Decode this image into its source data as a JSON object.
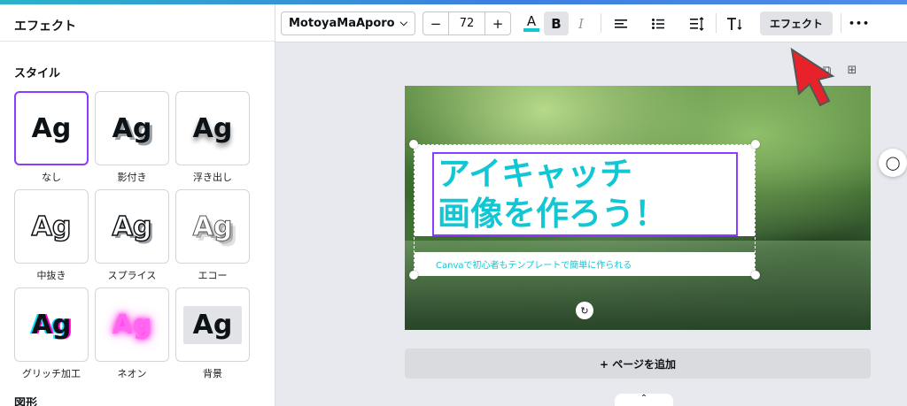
{
  "panel": {
    "title": "エフェクト",
    "styles_title": "スタイル",
    "shapes_title": "図形",
    "styles": [
      {
        "preview": "Ag",
        "label": "なし",
        "selected": true
      },
      {
        "preview": "Ag",
        "label": "影付き"
      },
      {
        "preview": "Ag",
        "label": "浮き出し"
      },
      {
        "preview": "Ag",
        "label": "中抜き"
      },
      {
        "preview": "Ag",
        "label": "スプライス"
      },
      {
        "preview": "Ag",
        "label": "エコー"
      },
      {
        "preview": "Ag",
        "label": "グリッチ加工"
      },
      {
        "preview": "Ag",
        "label": "ネオン"
      },
      {
        "preview": "Ag",
        "label": "背景"
      }
    ]
  },
  "toolbar": {
    "font": "MotoyaMaAporo",
    "font_size": "72",
    "minus": "−",
    "plus": "+",
    "color_icon": "A",
    "bold_icon": "B",
    "italic_icon": "I",
    "effect_label": "エフェクト",
    "more_label": "•••"
  },
  "canvas": {
    "heading_line1": "アイキャッチ",
    "heading_line2": "画像を作ろう！",
    "subtitle": "Canvaで初心者もテンプレートで簡単に作られる",
    "add_page": "+ ページを追加"
  },
  "colors": {
    "accent": "#8b3dff",
    "text_cyan": "#12c7d4",
    "arrow_red": "#e8222a"
  }
}
